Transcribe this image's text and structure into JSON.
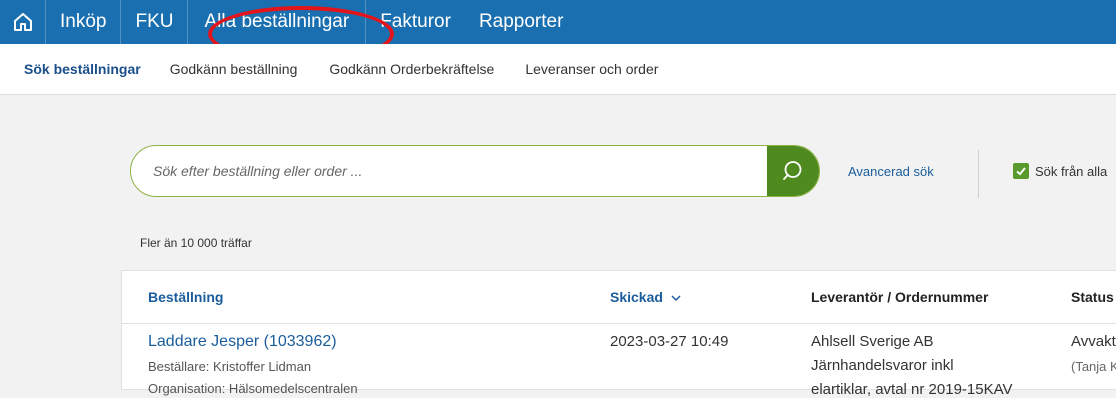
{
  "topnav": {
    "items": [
      "Inköp",
      "FKU",
      "Alla beställningar",
      "Fakturor",
      "Rapporter"
    ]
  },
  "subnav": {
    "items": [
      "Sök beställningar",
      "Godkänn beställning",
      "Godkänn Orderbekräftelse",
      "Leveranser och order"
    ]
  },
  "search": {
    "placeholder": "Sök efter beställning eller order ...",
    "advanced_label": "Avancerad sök",
    "checkbox_label": "Sök från alla",
    "checkbox_checked": true
  },
  "results": {
    "count_text": "Fler än 10 000 träffar",
    "columns": {
      "order": "Beställning",
      "sent": "Skickad",
      "supplier": "Leverantör / Ordernummer",
      "status": "Status"
    },
    "rows": [
      {
        "title": "Laddare Jesper (1033962)",
        "orderer": "Beställare: Kristoffer Lidman",
        "organization": "Organisation: Hälsomedelscentralen",
        "sent": "2023-03-27 10:49",
        "supplier": "Ahlsell Sverige AB",
        "supplier_desc": "Järnhandelsvaror inkl",
        "supplier_more": "elartiklar, avtal nr 2019-15KAV",
        "status": "Avvaktar",
        "status_by": "(Tanja Karlsson)"
      }
    ]
  },
  "colors": {
    "topnav_bg": "#1a6fb0",
    "highlight_oval": "#e3151a",
    "search_button": "#4e8a1e",
    "link": "#1b5d9c"
  }
}
